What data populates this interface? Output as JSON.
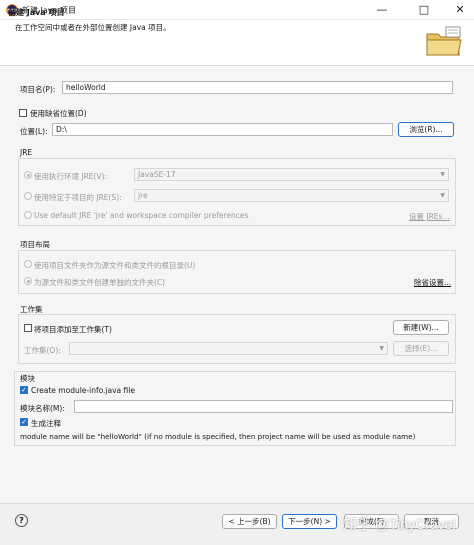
{
  "window": {
    "title": "新建 Java 项目",
    "minimize": "—",
    "maximize": "□",
    "close": "✕"
  },
  "header": {
    "title": "创建 Java 项目",
    "subtitle": "在工作空间中或者在外部位置创建 Java 项目。"
  },
  "project": {
    "name_label": "项目名(P):",
    "name_value": "helloWorld",
    "use_default_location": "使用缺省位置(D)",
    "location_label": "位置(L):",
    "location_value": "D:\\",
    "browse": "浏览(R)..."
  },
  "jre": {
    "group_label": "JRE",
    "option1": "使用执行环境 JRE(V):",
    "option1_value": "JavaSE-17",
    "option2": "使用特定于项目的 JRE(S):",
    "option2_value": "jre",
    "option3": "Use default JRE 'jre' and workspace compiler preferences",
    "configure": "设置 JREs..."
  },
  "layout": {
    "group_label": "项目布局",
    "option1": "使用项目文件夹作为源文件和类文件的根目录(U)",
    "option2": "为源文件和类文件创建单独的文件夹(C)",
    "configure": "除省设置..."
  },
  "working_sets": {
    "group_label": "工作集",
    "add_label": "将项目添加至工作集(T)",
    "new_button": "新建(W)...",
    "sets_label": "工作集(O):",
    "select_button": "选择(E)..."
  },
  "module": {
    "group_label": "模块",
    "create_label": "Create module-info.java file",
    "name_label": "模块名称(M):",
    "comments_label": "生成注释",
    "note": "module name will be \"helloWorld\"  (if no module is specified, then project name will be used as module name)"
  },
  "footer": {
    "help": "?",
    "back": "< 上一步(B)",
    "next": "下一步(N) >",
    "finish": "完成(F)",
    "cancel": "取消"
  },
  "watermark": "知乎 @TinyCravel",
  "colors": {
    "accent": "#2a73c9",
    "footer_bg": "#f0f0f0",
    "body_bg": "#f5f5f5"
  }
}
